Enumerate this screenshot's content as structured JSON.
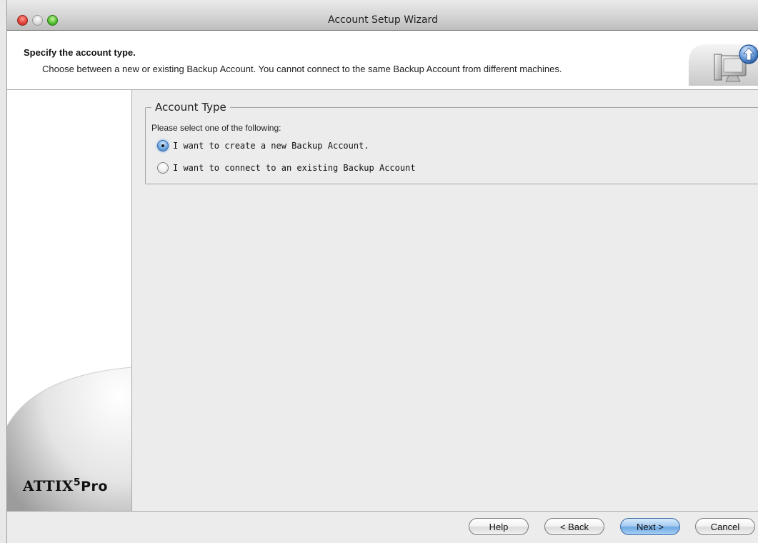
{
  "window": {
    "title": "Account Setup Wizard"
  },
  "header": {
    "title": "Specify the account type.",
    "description": "Choose between a new or existing Backup Account. You cannot connect to the same Backup Account from different machines.",
    "icon": "computer-upload-icon"
  },
  "sidebar": {
    "logo": {
      "main": "ATTIX",
      "sup": "5",
      "suffix": "Pro"
    }
  },
  "group": {
    "legend": "Account Type",
    "instruction": "Please select one of the following:",
    "options": [
      {
        "label": "I want to create a new Backup Account.",
        "selected": true
      },
      {
        "label": "I want to connect to an existing Backup Account",
        "selected": false
      }
    ]
  },
  "buttons": {
    "help": "Help",
    "back": "< Back",
    "next": "Next >",
    "cancel": "Cancel"
  },
  "colors": {
    "accent": "#6fa8e2",
    "close": "#e0443a",
    "zoom": "#55c232"
  }
}
